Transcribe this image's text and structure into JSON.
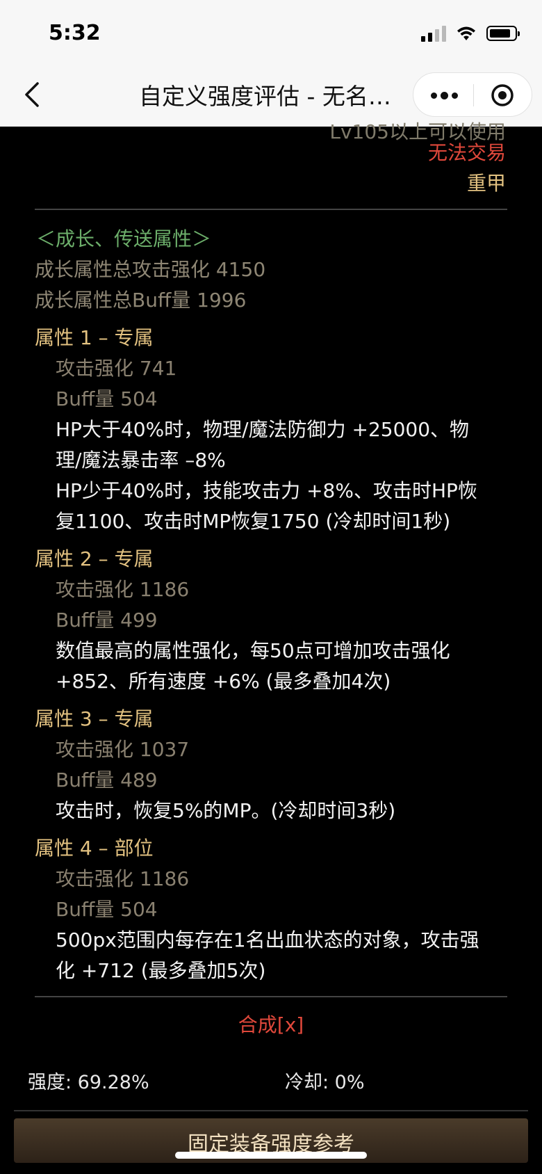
{
  "status": {
    "time": "5:32"
  },
  "nav": {
    "title": "自定义强度评估 - 无名…"
  },
  "item": {
    "cut_text": "Lv105以上可以使用",
    "trade": "无法交易",
    "armor": "重甲"
  },
  "growth": {
    "header": "＜成长、传送属性＞",
    "total_atk": "成长属性总攻击强化 4150",
    "total_buff": "成长属性总Buff量 1996"
  },
  "attributes": [
    {
      "title": "属性 1 – 专属",
      "atk": "攻击强化  741",
      "buff": "Buff量  504",
      "desc": [
        "HP大于40%时，物理/魔法防御力 +25000、物",
        "理/魔法暴击率 –8%",
        "HP少于40%时，技能攻击力 +8%、攻击时HP恢",
        "复1100、攻击时MP恢复1750 (冷却时间1秒)"
      ]
    },
    {
      "title": "属性 2 – 专属",
      "atk": "攻击强化  1186",
      "buff": "Buff量  499",
      "desc": [
        "数值最高的属性强化，每50点可增加攻击强化",
        "+852、所有速度 +6% (最多叠加4次)"
      ]
    },
    {
      "title": "属性 3 – 专属",
      "atk": "攻击强化  1037",
      "buff": "Buff量  489",
      "desc": [
        "攻击时，恢复5%的MP。(冷却时间3秒)"
      ]
    },
    {
      "title": "属性 4 – 部位",
      "atk": "攻击强化  1186",
      "buff": "Buff量  504",
      "desc": [
        "500px范围内每存在1名出血状态的对象，攻击强",
        "化 +712 (最多叠加5次)"
      ]
    }
  ],
  "synth": "合成[x]",
  "stats": {
    "strength": "强度: 69.28%",
    "cooldown": "冷却: 0%"
  },
  "bottom_button": "固定装备强度参考",
  "colors": {
    "gold": "#e3c281",
    "red": "#e0483b",
    "green": "#6cae6a",
    "grey": "#8e8674"
  }
}
